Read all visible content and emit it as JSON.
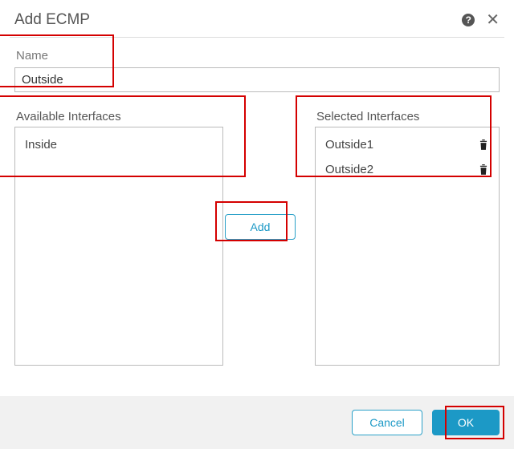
{
  "header": {
    "title": "Add ECMP"
  },
  "name_field": {
    "label": "Name",
    "value": "Outside"
  },
  "available": {
    "label": "Available Interfaces",
    "items": [
      "Inside"
    ]
  },
  "selected": {
    "label": "Selected Interfaces",
    "items": [
      "Outside1",
      "Outside2"
    ]
  },
  "buttons": {
    "add": "Add",
    "cancel": "Cancel",
    "ok": "OK"
  }
}
